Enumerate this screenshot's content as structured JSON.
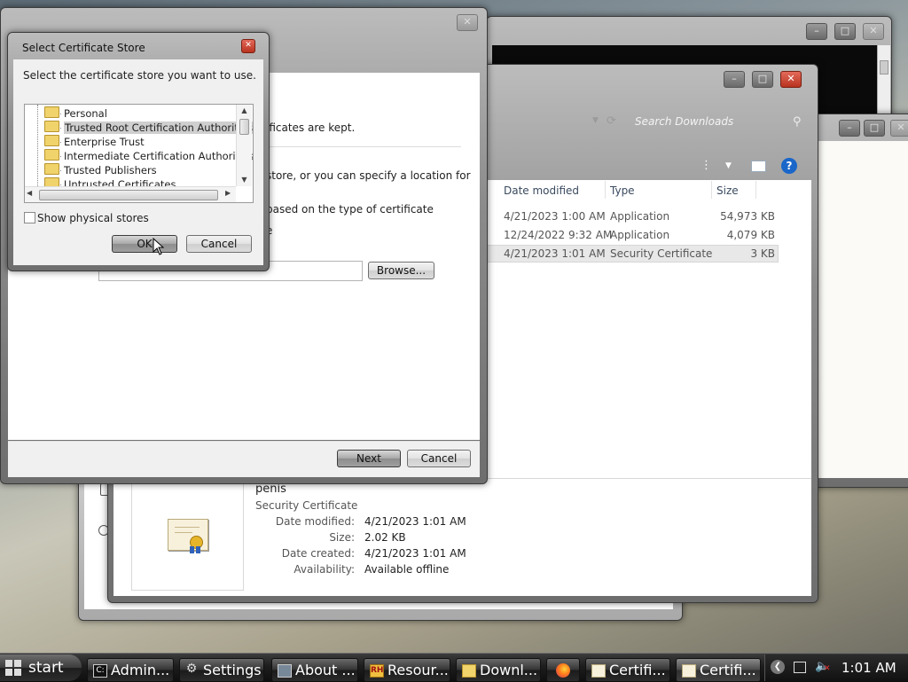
{
  "cert_store_dialog": {
    "title": "Select Certificate Store",
    "prompt": "Select the certificate store you want to use.",
    "stores": [
      "Personal",
      "Trusted Root Certification Authorities",
      "Enterprise Trust",
      "Intermediate Certification Authorities",
      "Trusted Publishers",
      "Untrusted Certificates"
    ],
    "selected_index": 1,
    "show_physical_label": "Show physical stores",
    "ok_label": "OK",
    "cancel_label": "Cancel"
  },
  "import_wizard": {
    "text1": "ificates are kept.",
    "text2": "store, or you can specify a location for",
    "text3": "based on the type of certificate",
    "text4": "e",
    "browse_label": "Browse...",
    "next_label": "Next",
    "cancel_label": "Cancel"
  },
  "explorer": {
    "search_placeholder": "Search Downloads",
    "columns": [
      "Date modified",
      "Type",
      "Size"
    ],
    "rows": [
      {
        "date": "4/21/2023 1:00 AM",
        "type": "Application",
        "size": "54,973 KB"
      },
      {
        "date": "12/24/2022 9:32 AM",
        "type": "Application",
        "size": "4,079 KB"
      },
      {
        "date": "4/21/2023 1:01 AM",
        "type": "Security Certificate",
        "size": "3 KB"
      }
    ],
    "selected_row": 2,
    "details": {
      "name": "penis",
      "type": "Security Certificate",
      "date_modified_label": "Date modified:",
      "date_modified": "4/21/2023 1:01 AM",
      "size_label": "Size:",
      "size": "2.02 KB",
      "date_created_label": "Date created:",
      "date_created": "4/21/2023 1:01 AM",
      "availability_label": "Availability:",
      "availability": "Available offline"
    }
  },
  "taskbar": {
    "start_label": "start",
    "items": [
      {
        "label": "Admin...",
        "icon": "console-icon"
      },
      {
        "label": "Settings",
        "icon": "gear-icon"
      },
      {
        "label": "About ...",
        "icon": "window-icon"
      },
      {
        "label": "Resour...",
        "icon": "rh-icon"
      },
      {
        "label": "Downl...",
        "icon": "folder-icon"
      },
      {
        "label": "",
        "icon": "firefox-icon"
      },
      {
        "label": "Certifi...",
        "icon": "certificate-icon"
      },
      {
        "label": "Certifi...",
        "icon": "certificate-icon"
      }
    ],
    "clock": "1:01 AM"
  },
  "colors": {
    "selection": "#cfcfcf",
    "close_button": "#c8412c",
    "taskbar": "#1a1a1a"
  }
}
